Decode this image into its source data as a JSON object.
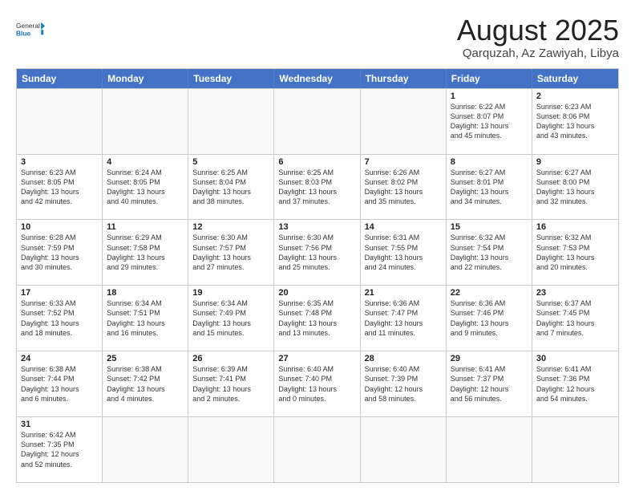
{
  "logo": {
    "text_general": "General",
    "text_blue": "Blue"
  },
  "title": "August 2025",
  "location": "Qarquzah, Az Zawiyah, Libya",
  "days_of_week": [
    "Sunday",
    "Monday",
    "Tuesday",
    "Wednesday",
    "Thursday",
    "Friday",
    "Saturday"
  ],
  "weeks": [
    [
      {
        "day": "",
        "info": ""
      },
      {
        "day": "",
        "info": ""
      },
      {
        "day": "",
        "info": ""
      },
      {
        "day": "",
        "info": ""
      },
      {
        "day": "",
        "info": ""
      },
      {
        "day": "1",
        "info": "Sunrise: 6:22 AM\nSunset: 8:07 PM\nDaylight: 13 hours\nand 45 minutes."
      },
      {
        "day": "2",
        "info": "Sunrise: 6:23 AM\nSunset: 8:06 PM\nDaylight: 13 hours\nand 43 minutes."
      }
    ],
    [
      {
        "day": "3",
        "info": "Sunrise: 6:23 AM\nSunset: 8:05 PM\nDaylight: 13 hours\nand 42 minutes."
      },
      {
        "day": "4",
        "info": "Sunrise: 6:24 AM\nSunset: 8:05 PM\nDaylight: 13 hours\nand 40 minutes."
      },
      {
        "day": "5",
        "info": "Sunrise: 6:25 AM\nSunset: 8:04 PM\nDaylight: 13 hours\nand 38 minutes."
      },
      {
        "day": "6",
        "info": "Sunrise: 6:25 AM\nSunset: 8:03 PM\nDaylight: 13 hours\nand 37 minutes."
      },
      {
        "day": "7",
        "info": "Sunrise: 6:26 AM\nSunset: 8:02 PM\nDaylight: 13 hours\nand 35 minutes."
      },
      {
        "day": "8",
        "info": "Sunrise: 6:27 AM\nSunset: 8:01 PM\nDaylight: 13 hours\nand 34 minutes."
      },
      {
        "day": "9",
        "info": "Sunrise: 6:27 AM\nSunset: 8:00 PM\nDaylight: 13 hours\nand 32 minutes."
      }
    ],
    [
      {
        "day": "10",
        "info": "Sunrise: 6:28 AM\nSunset: 7:59 PM\nDaylight: 13 hours\nand 30 minutes."
      },
      {
        "day": "11",
        "info": "Sunrise: 6:29 AM\nSunset: 7:58 PM\nDaylight: 13 hours\nand 29 minutes."
      },
      {
        "day": "12",
        "info": "Sunrise: 6:30 AM\nSunset: 7:57 PM\nDaylight: 13 hours\nand 27 minutes."
      },
      {
        "day": "13",
        "info": "Sunrise: 6:30 AM\nSunset: 7:56 PM\nDaylight: 13 hours\nand 25 minutes."
      },
      {
        "day": "14",
        "info": "Sunrise: 6:31 AM\nSunset: 7:55 PM\nDaylight: 13 hours\nand 24 minutes."
      },
      {
        "day": "15",
        "info": "Sunrise: 6:32 AM\nSunset: 7:54 PM\nDaylight: 13 hours\nand 22 minutes."
      },
      {
        "day": "16",
        "info": "Sunrise: 6:32 AM\nSunset: 7:53 PM\nDaylight: 13 hours\nand 20 minutes."
      }
    ],
    [
      {
        "day": "17",
        "info": "Sunrise: 6:33 AM\nSunset: 7:52 PM\nDaylight: 13 hours\nand 18 minutes."
      },
      {
        "day": "18",
        "info": "Sunrise: 6:34 AM\nSunset: 7:51 PM\nDaylight: 13 hours\nand 16 minutes."
      },
      {
        "day": "19",
        "info": "Sunrise: 6:34 AM\nSunset: 7:49 PM\nDaylight: 13 hours\nand 15 minutes."
      },
      {
        "day": "20",
        "info": "Sunrise: 6:35 AM\nSunset: 7:48 PM\nDaylight: 13 hours\nand 13 minutes."
      },
      {
        "day": "21",
        "info": "Sunrise: 6:36 AM\nSunset: 7:47 PM\nDaylight: 13 hours\nand 11 minutes."
      },
      {
        "day": "22",
        "info": "Sunrise: 6:36 AM\nSunset: 7:46 PM\nDaylight: 13 hours\nand 9 minutes."
      },
      {
        "day": "23",
        "info": "Sunrise: 6:37 AM\nSunset: 7:45 PM\nDaylight: 13 hours\nand 7 minutes."
      }
    ],
    [
      {
        "day": "24",
        "info": "Sunrise: 6:38 AM\nSunset: 7:44 PM\nDaylight: 13 hours\nand 6 minutes."
      },
      {
        "day": "25",
        "info": "Sunrise: 6:38 AM\nSunset: 7:42 PM\nDaylight: 13 hours\nand 4 minutes."
      },
      {
        "day": "26",
        "info": "Sunrise: 6:39 AM\nSunset: 7:41 PM\nDaylight: 13 hours\nand 2 minutes."
      },
      {
        "day": "27",
        "info": "Sunrise: 6:40 AM\nSunset: 7:40 PM\nDaylight: 13 hours\nand 0 minutes."
      },
      {
        "day": "28",
        "info": "Sunrise: 6:40 AM\nSunset: 7:39 PM\nDaylight: 12 hours\nand 58 minutes."
      },
      {
        "day": "29",
        "info": "Sunrise: 6:41 AM\nSunset: 7:37 PM\nDaylight: 12 hours\nand 56 minutes."
      },
      {
        "day": "30",
        "info": "Sunrise: 6:41 AM\nSunset: 7:36 PM\nDaylight: 12 hours\nand 54 minutes."
      }
    ],
    [
      {
        "day": "31",
        "info": "Sunrise: 6:42 AM\nSunset: 7:35 PM\nDaylight: 12 hours\nand 52 minutes."
      },
      {
        "day": "",
        "info": ""
      },
      {
        "day": "",
        "info": ""
      },
      {
        "day": "",
        "info": ""
      },
      {
        "day": "",
        "info": ""
      },
      {
        "day": "",
        "info": ""
      },
      {
        "day": "",
        "info": ""
      }
    ]
  ]
}
